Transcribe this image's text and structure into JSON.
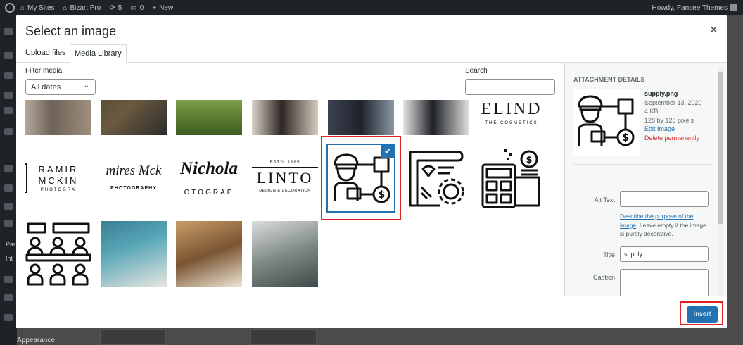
{
  "adminbar": {
    "my_sites": "My Sites",
    "site_name": "Bizart Pro",
    "updates_count": "5",
    "comments_count": "0",
    "new_label": "New",
    "howdy": "Howdy, Fansee Themes"
  },
  "sidemenu": {
    "par_label": "Par",
    "int_label": "Int",
    "appearance_label": "Appearance"
  },
  "modal": {
    "title": "Select an image",
    "close_label": "×",
    "tabs": [
      {
        "label": "Upload files",
        "active": false
      },
      {
        "label": "Media Library",
        "active": true
      }
    ],
    "filter_label": "Filter media",
    "date_filter": "All dates",
    "search_label": "Search",
    "search_value": ""
  },
  "grid": {
    "logo_tiles": {
      "ramir_line1": "RAMIR",
      "ramir_line2": "MCKIN",
      "ramir_line3": "PHOTOGRA",
      "mckenzie_script": "mires Mck",
      "mckenzie_sub": "PHOTOGRAPHY",
      "nichola_script": "Nichola",
      "nichola_sub": "OTOGRAP",
      "linto_est": "ESTD. 1985",
      "linto_name": "LINTO",
      "linto_sub": "DESIGN & DECORATION",
      "elind_name": "ELIND",
      "elind_sub": "THE COSMETICS"
    },
    "selected_item": "supply.png",
    "check_mark": "✔"
  },
  "details": {
    "heading": "ATTACHMENT DETAILS",
    "filename": "supply.png",
    "date": "September 13, 2020",
    "size": "4 KB",
    "dimensions": "128 by 128 pixels",
    "edit_link": "Edit Image",
    "delete_link": "Delete permanently",
    "alt_label": "Alt Text",
    "alt_value": "",
    "alt_help_link1": "Describe the purpose of the",
    "alt_help_link2": "image",
    "alt_help_rest": ". Leave empty if the image is purely decorative.",
    "title_label": "Title",
    "title_value": "supply",
    "caption_label": "Caption",
    "caption_value": ""
  },
  "toolbar": {
    "insert_label": "Insert"
  },
  "colors": {
    "primary": "#2271b1",
    "highlight_box": "#e02424",
    "danger": "#d63638"
  }
}
